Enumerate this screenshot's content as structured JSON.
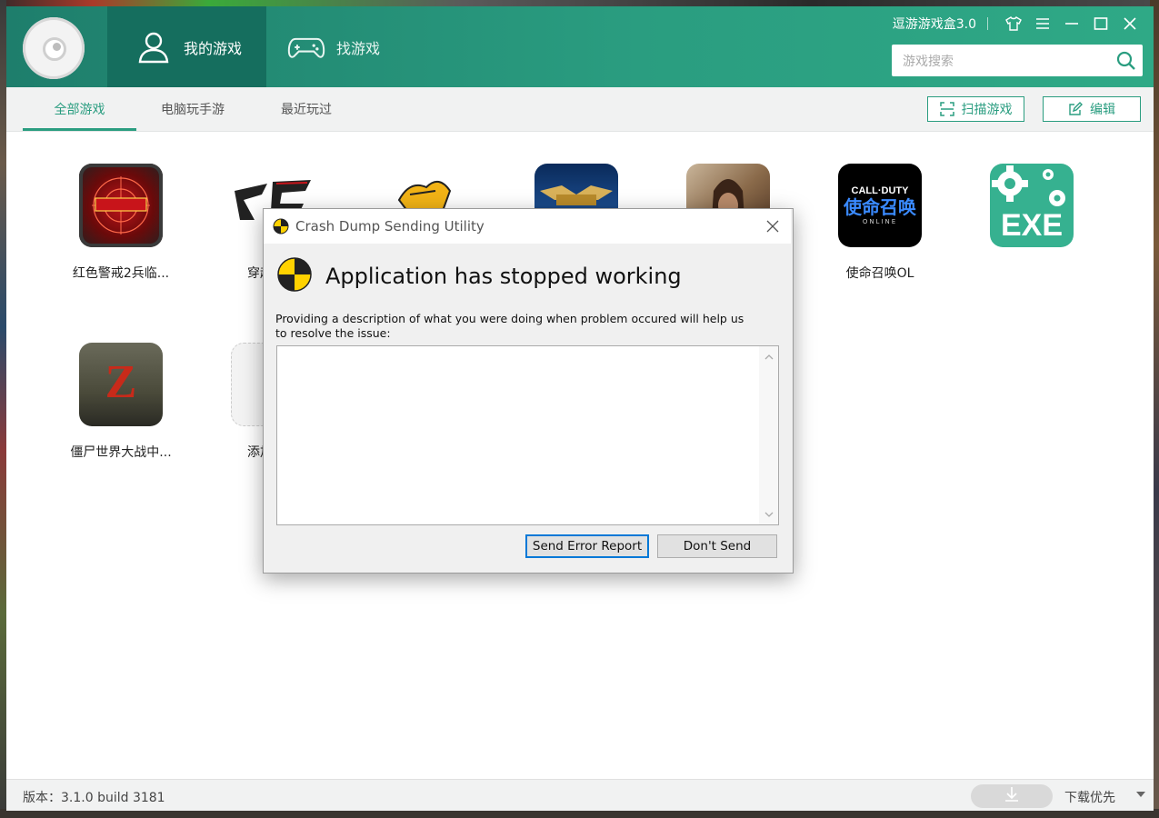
{
  "app": {
    "title": "逗游游戏盒3.0",
    "nav": {
      "my_games": "我的游戏",
      "find_games": "找游戏"
    },
    "search": {
      "placeholder": "游戏搜索"
    },
    "subtabs": {
      "all": "全部游戏",
      "pc_mobile": "电脑玩手游",
      "recent": "最近玩过"
    },
    "buttons": {
      "scan": "扫描游戏",
      "edit": "编辑"
    },
    "games": [
      {
        "name": "红色警戒2兵临...",
        "icon": "red-alert-2-icon"
      },
      {
        "name": "穿越火线",
        "icon": "crossfire-icon"
      },
      {
        "name": "",
        "icon": "game-3-icon"
      },
      {
        "name": "",
        "icon": "league-of-legends-icon"
      },
      {
        "name": "",
        "icon": "assassin-icon"
      },
      {
        "name": "使命召唤OL",
        "icon": "call-of-duty-online-icon",
        "icon_text": "CALL·DUTY",
        "icon_subtext": "使命召唤",
        "icon_tag": "ONLINE"
      },
      {
        "name": "",
        "icon": "exe-icon",
        "icon_text": "EXE"
      },
      {
        "name": "僵尸世界大战中...",
        "icon": "world-war-z-icon",
        "icon_text": "Z"
      },
      {
        "name": "添加游戏",
        "icon": "add-game-icon"
      }
    ],
    "footer": {
      "version": "版本：3.1.0 build 3181",
      "download_priority": "下载优先"
    },
    "colors": {
      "accent": "#2a9d80",
      "header_dark": "#156e5e"
    }
  },
  "dialog": {
    "title": "Crash Dump Sending Utility",
    "heading": "Application has stopped working",
    "description": "Providing a description of what you were doing when problem occured will help us to resolve the issue:",
    "textarea_value": "",
    "buttons": {
      "send": "Send Error Report",
      "dont_send": "Don't Send"
    }
  }
}
